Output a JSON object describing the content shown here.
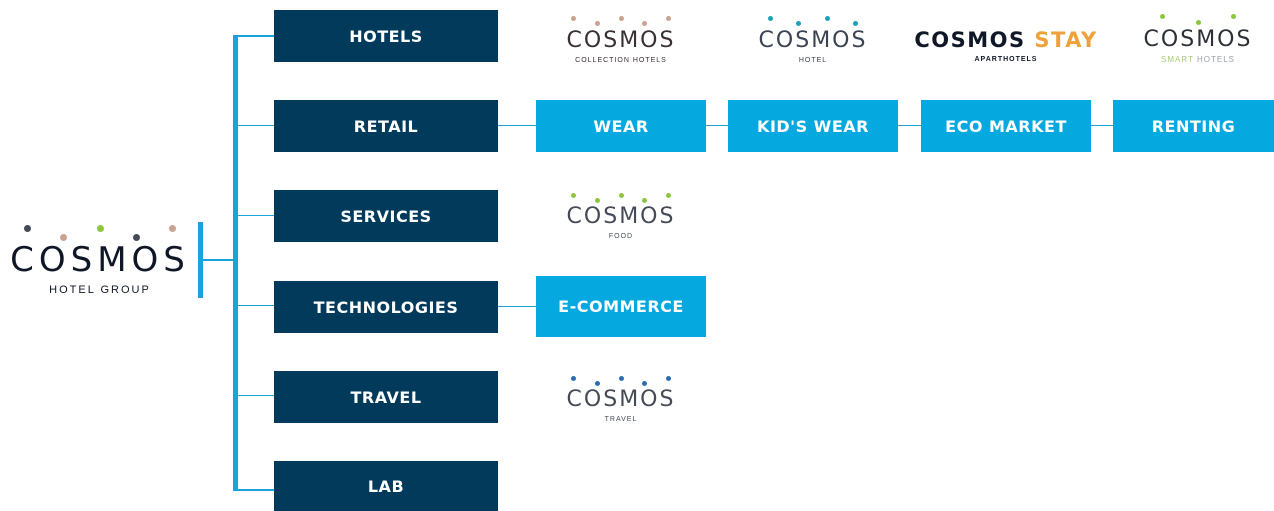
{
  "group_logo": {
    "wordmark": "COSMOS",
    "subtitle": "HOTEL GROUP",
    "dot_colors": [
      "#444b57",
      "#c9a291",
      "#8cc63f",
      "#444b57",
      "#c9a291"
    ]
  },
  "divisions": [
    {
      "label": "HOTELS"
    },
    {
      "label": "RETAIL"
    },
    {
      "label": "SERVICES"
    },
    {
      "label": "TECHNOLOGIES"
    },
    {
      "label": "TRAVEL"
    },
    {
      "label": "LAB"
    }
  ],
  "hotel_brands": [
    {
      "wordmark": "COSMOS",
      "subtitle": "COLLECTION HOTELS",
      "dot_color": "#c9a291",
      "text_color": "#3a2f33"
    },
    {
      "wordmark": "COSMOS",
      "subtitle": "HOTEL",
      "dot_color": "#1aa3b8",
      "text_color": "#3b4452"
    },
    {
      "wordmark": "COSMOS",
      "wordmark_accent": "STAY",
      "subtitle": "APARTHOTELS",
      "text_color": "#101828",
      "accent_color": "#f0a23a"
    },
    {
      "wordmark": "COSMOS",
      "subtitle": "SMART",
      "subtitle_2": "HOTELS",
      "dot_color": "#8cc63f",
      "text_color": "#2c3038",
      "subtitle_color": "#a9c97a"
    }
  ],
  "retail_units": [
    {
      "label": "WEAR"
    },
    {
      "label": "KID'S WEAR"
    },
    {
      "label": "ECO MARKET"
    },
    {
      "label": "RENTING"
    }
  ],
  "services_brand": {
    "wordmark": "COSMOS",
    "subtitle": "FOOD",
    "dot_color": "#8cc63f",
    "text_color": "#444b57"
  },
  "technologies_unit": {
    "label": "E-COMMERCE"
  },
  "travel_brand": {
    "wordmark": "COSMOS",
    "subtitle": "TRAVEL",
    "dot_color": "#2c6fb0",
    "text_color": "#444b57"
  },
  "colors": {
    "dark_box": "#023a5c",
    "light_box": "#06a9df",
    "connector": "#1aa3d9"
  }
}
